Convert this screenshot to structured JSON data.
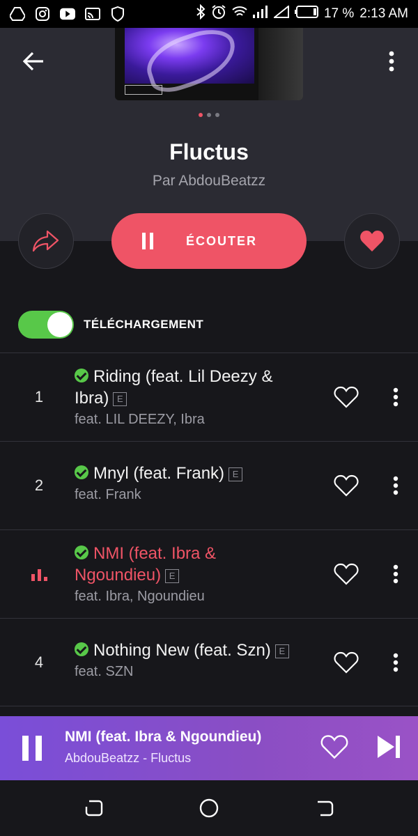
{
  "status_bar": {
    "battery": "17 %",
    "time": "2:13 AM",
    "icons": [
      "drive-icon",
      "instagram-icon",
      "youtube-icon",
      "cast-icon",
      "shield-icon",
      "bluetooth-icon",
      "alarm-icon",
      "wifi-icon",
      "signal-icon",
      "battery-icon"
    ]
  },
  "header": {
    "album_title": "Fluctus",
    "album_artist": "Par AbdouBeatzz",
    "carousel_dots": 3,
    "carousel_active": 0
  },
  "actions": {
    "play_label": "ÉCOUTER"
  },
  "download": {
    "label": "TÉLÉCHARGEMENT",
    "enabled": true
  },
  "tracks": [
    {
      "number": "1",
      "title": "Riding (feat. Lil Deezy & Ibra)",
      "explicit": "E",
      "artists": "feat. LIL DEEZY, Ibra",
      "active": false,
      "downloaded": true
    },
    {
      "number": "2",
      "title": "Mnyl (feat. Frank)",
      "explicit": "E",
      "artists": "feat. Frank",
      "active": false,
      "downloaded": true
    },
    {
      "number": "",
      "title": "NMI (feat. Ibra & Ngoundieu)",
      "explicit": "E",
      "artists": "feat. Ibra, Ngoundieu",
      "active": true,
      "downloaded": true
    },
    {
      "number": "4",
      "title": "Nothing New (feat. Szn)",
      "explicit": "E",
      "artists": "feat. SZN",
      "active": false,
      "downloaded": true
    }
  ],
  "mini_player": {
    "title": "NMI (feat. Ibra & Ngoundieu)",
    "subtitle": "AbdouBeatzz - Fluctus"
  },
  "colors": {
    "accent": "#ef5466",
    "toggle_on": "#58c849",
    "header_bg": "#2b2b33",
    "page_bg": "#17171b"
  }
}
